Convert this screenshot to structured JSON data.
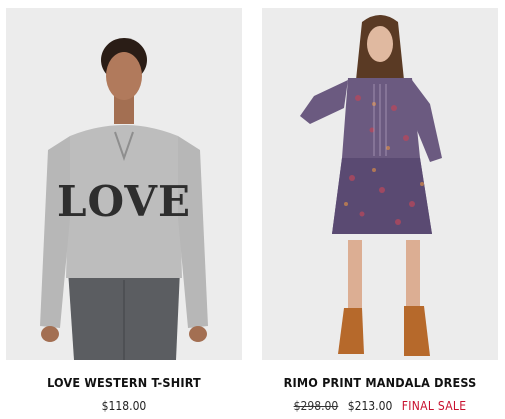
{
  "products": [
    {
      "name": "LOVE WESTERN T-SHIRT",
      "price": "$118.00",
      "graphic_text": "LOVE",
      "image_icon": "model-in-grey-love-tshirt"
    },
    {
      "name": "RIMO PRINT MANDALA DRESS",
      "original_price": "$298.00",
      "sale_price": "$213.00",
      "badge": "FINAL SALE",
      "badge_color": "#c8102e",
      "image_icon": "model-in-printed-dress"
    }
  ]
}
